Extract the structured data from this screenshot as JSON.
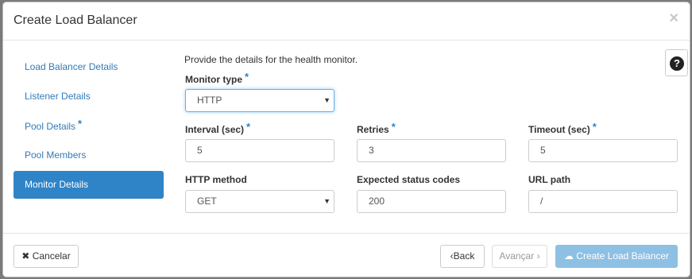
{
  "modal": {
    "title": "Create Load Balancer",
    "close": "×"
  },
  "nav": {
    "items": [
      {
        "label": "Load Balancer Details",
        "required": false
      },
      {
        "label": "Listener Details",
        "required": false
      },
      {
        "label": "Pool Details",
        "required": true
      },
      {
        "label": "Pool Members",
        "required": false
      },
      {
        "label": "Monitor Details",
        "required": false,
        "active": true
      }
    ]
  },
  "form": {
    "intro": "Provide the details for the health monitor.",
    "monitor_type": {
      "label": "Monitor type",
      "value": "HTTP"
    },
    "interval": {
      "label": "Interval (sec)",
      "value": "5"
    },
    "retries": {
      "label": "Retries",
      "value": "3"
    },
    "timeout": {
      "label": "Timeout (sec)",
      "value": "5"
    },
    "http_method": {
      "label": "HTTP method",
      "value": "GET"
    },
    "expected_codes": {
      "label": "Expected status codes",
      "value": "200"
    },
    "url_path": {
      "label": "URL path",
      "value": "/"
    },
    "required_mark": "*",
    "help": "?"
  },
  "footer": {
    "cancel": "Cancelar",
    "back": "Back",
    "next": "Avançar",
    "create": "Create Load Balancer"
  },
  "icons": {
    "cancel": "close-icon",
    "back": "chevron-left-icon",
    "next": "chevron-right-icon",
    "create": "cloud-upload-icon",
    "help": "question-circle-icon"
  },
  "colors": {
    "accent": "#2f84c7",
    "link": "#337ab7",
    "primary_disabled": "#8ec0e4"
  }
}
